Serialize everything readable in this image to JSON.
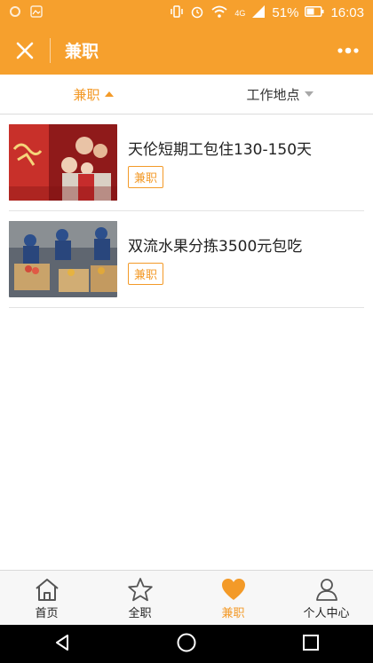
{
  "status": {
    "network": "4G",
    "battery": "51%",
    "time": "16:03"
  },
  "appbar": {
    "title": "兼职"
  },
  "filters": [
    {
      "label": "兼职"
    },
    {
      "label": "工作地点"
    }
  ],
  "jobs": [
    {
      "title": "天伦短期工包住130-150天",
      "tag": "兼职"
    },
    {
      "title": "双流水果分拣3500元包吃",
      "tag": "兼职"
    }
  ],
  "tabs": [
    {
      "label": "首页"
    },
    {
      "label": "全职"
    },
    {
      "label": "兼职"
    },
    {
      "label": "个人中心"
    }
  ],
  "colors": {
    "accent": "#f6a02d",
    "tab_active": "#f39a28"
  }
}
